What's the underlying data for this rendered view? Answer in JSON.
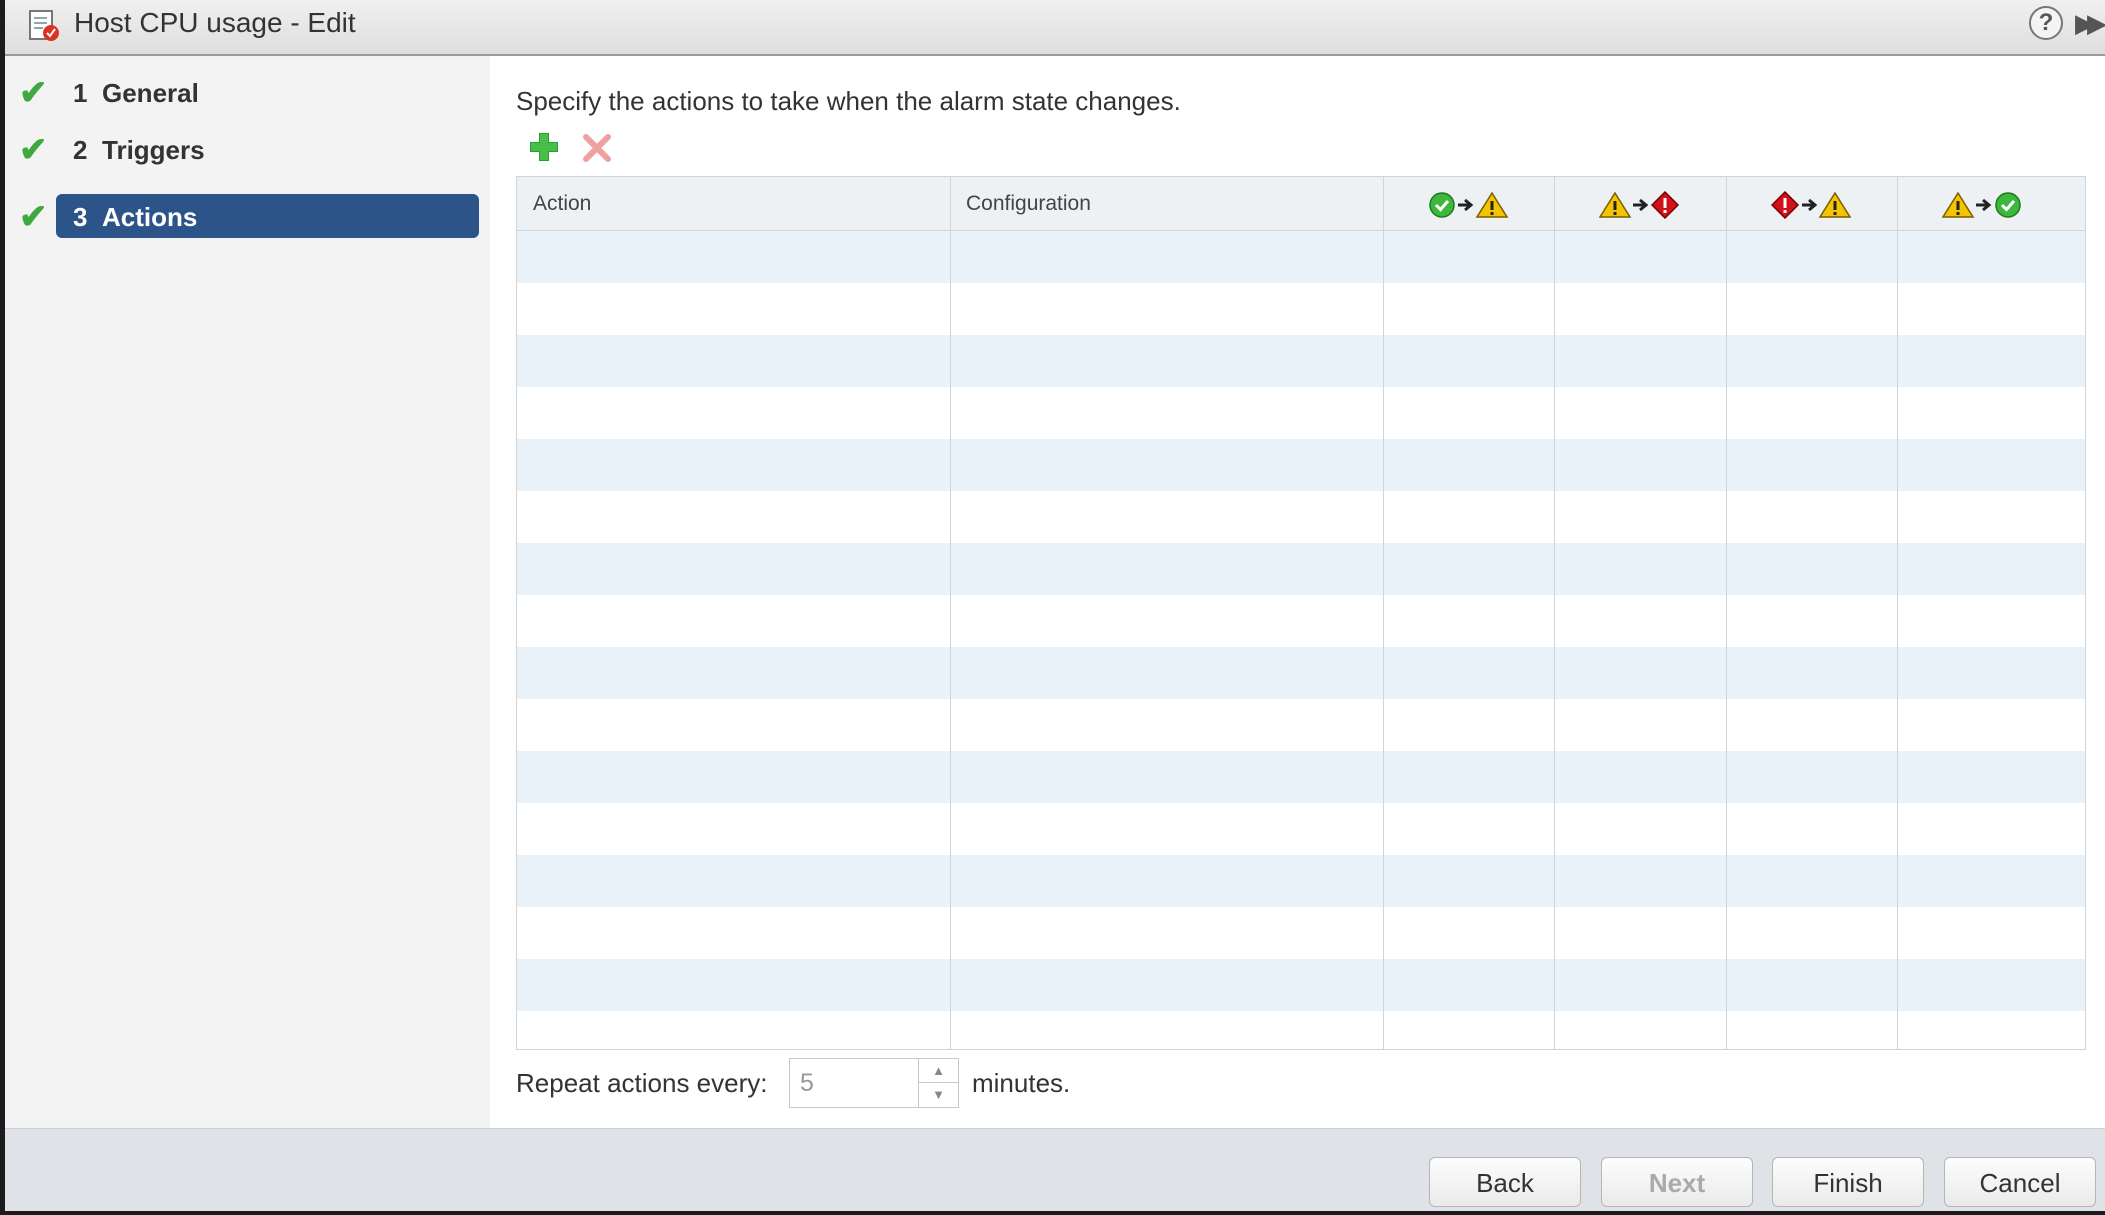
{
  "window": {
    "title": "Host CPU usage - Edit",
    "help_label": "?",
    "expand_label": "▶▶"
  },
  "steps": [
    {
      "num": "1",
      "label": "General",
      "complete": true,
      "active": false
    },
    {
      "num": "2",
      "label": "Triggers",
      "complete": true,
      "active": false
    },
    {
      "num": "3",
      "label": "Actions",
      "complete": true,
      "active": true
    }
  ],
  "main": {
    "instruction": "Specify the actions to take when the alarm state changes.",
    "toolbar": {
      "add_icon": "green-plus-icon",
      "delete_icon": "red-x-icon"
    },
    "table": {
      "columns": [
        {
          "label": "Action"
        },
        {
          "label": "Configuration"
        },
        {
          "label": "",
          "transition": [
            "normal",
            "warning"
          ]
        },
        {
          "label": "",
          "transition": [
            "warning",
            "alert"
          ]
        },
        {
          "label": "",
          "transition": [
            "alert",
            "warning"
          ]
        },
        {
          "label": "",
          "transition": [
            "warning",
            "normal"
          ]
        }
      ],
      "rows": []
    },
    "repeat": {
      "label": "Repeat actions every:",
      "value": "5",
      "unit": "minutes."
    }
  },
  "footer": {
    "back": "Back",
    "next": "Next",
    "finish": "Finish",
    "cancel": "Cancel"
  },
  "colors": {
    "selected_step": "#2d5489",
    "check": "#3fa83f",
    "row_stripe": "#e9f1f9",
    "warning": "#f5c400",
    "alert": "#d0111b",
    "normal": "#3db83d"
  }
}
